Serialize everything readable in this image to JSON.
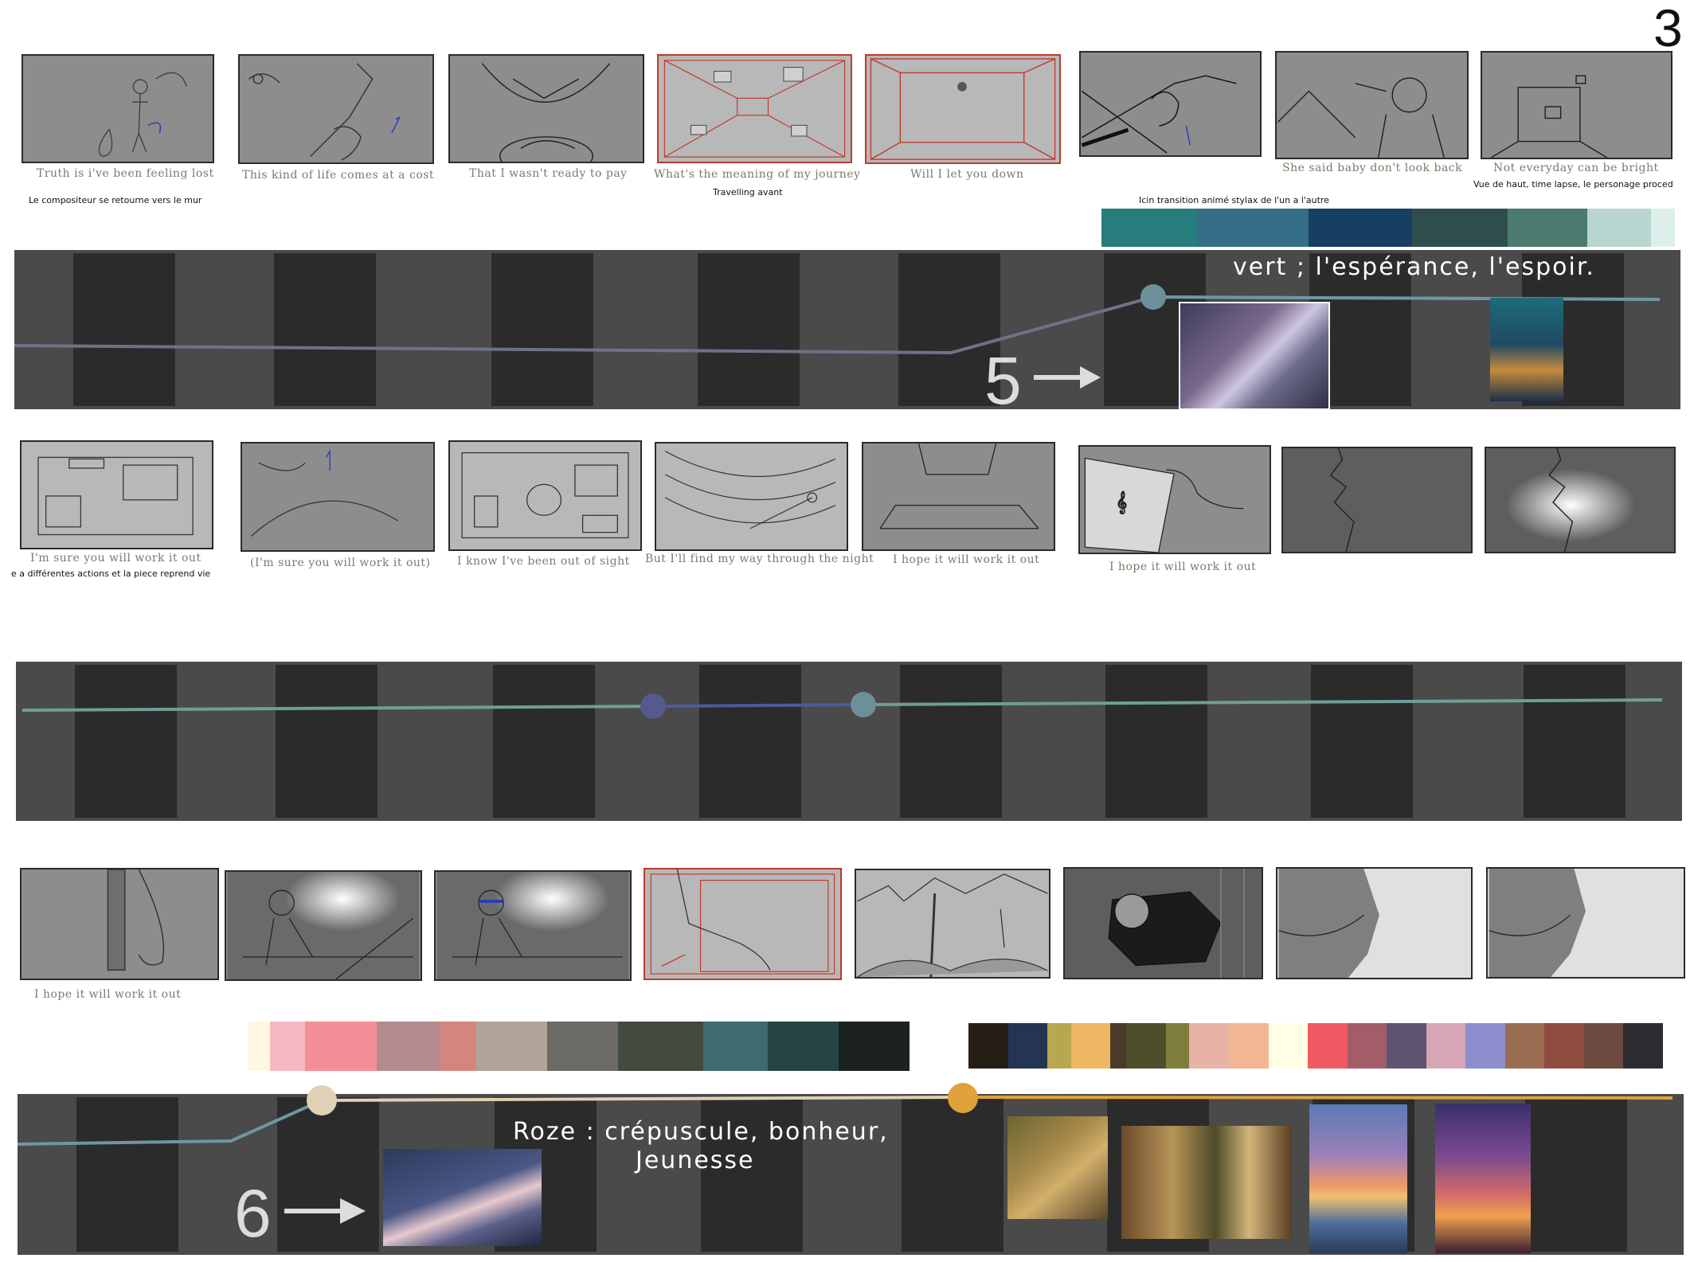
{
  "page_number": "3",
  "row1": {
    "captions": [
      "Truth is i've been feeling lost",
      "This kind of life comes at a cost",
      "That I wasn't ready to pay",
      "What's the meaning of my journey",
      "Will I let you down",
      "She said baby don't look back",
      "Not everyday can be bright"
    ],
    "notes": {
      "compositeur": "Le compositeur se retourne vers le mur",
      "travelling": "Travelling avant",
      "transition": "Icin transition animé stylax de l'un a l'autre",
      "vue": "Vue de haut, time lapse, le personage proced"
    }
  },
  "band1": {
    "theme_text": "vert ; l'espérance, l'espoir.",
    "act_number": "5",
    "palette": [
      "#277d7b",
      "#356e87",
      "#163f63",
      "#2f4d4d",
      "#4b7a6e",
      "#b8d5d0",
      "#dcefeb"
    ]
  },
  "row2": {
    "captions": [
      "I'm sure you will work it out",
      "(I'm sure you will work it out)",
      "I know I've been out of sight",
      "But I'll find my way through the night",
      "I hope it will work it out",
      "I hope it will work it out"
    ],
    "notes": {
      "actions": "e a différentes actions et la piece reprend vie"
    }
  },
  "row3": {
    "captions": [
      "I hope it will work it out"
    ]
  },
  "band3": {
    "theme_text_line1": "Roze   : crépuscule, bonheur,",
    "theme_text_line2": "Jeunesse",
    "act_number": "6",
    "palette_left": [
      "#fff7df",
      "#f6b8c0",
      "#f48f98",
      "#b48a8e",
      "#d5857c",
      "#b0a397",
      "#6b6a64",
      "#434a40",
      "#3f6b6f",
      "#254446",
      "#1b2220"
    ],
    "palette_right": [
      "#241e14",
      "#233553",
      "#b6a84f",
      "#efb764",
      "#4a3a2c",
      "#4c4f2a",
      "#7f7d3c",
      "#e6b3a6",
      "#f2b694",
      "#fffde6",
      "#f05a63",
      "#a45c69",
      "#5f5470",
      "#d7a6b5",
      "#8e8ecf",
      "#9a6c52",
      "#8f4c40",
      "#6c4a40",
      "#2c2c31"
    ]
  },
  "colors": {
    "band_bg": "#4a4a4a",
    "band_cell": "#2b2b2b",
    "line_green": "#6e9e98",
    "line_slate": "#6d7387",
    "line_blue": "#6f96a3",
    "node_teal": "#6c8f99",
    "node_purple": "#555a8a",
    "node_beige": "#e0d1b4",
    "node_orange": "#e2a23a"
  }
}
